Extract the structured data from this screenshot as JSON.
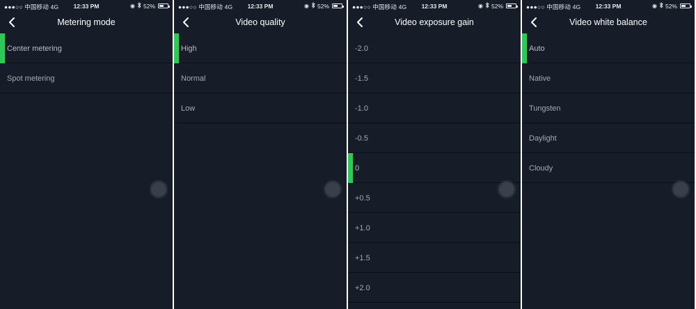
{
  "status_bar": {
    "carrier": "●●●○○ 中国移动  4G",
    "time": "12:33 PM",
    "battery": "52%",
    "battery_level": 0.52
  },
  "screens": [
    {
      "title": "Metering mode",
      "selected_index": 0,
      "items": [
        "Center metering",
        "Spot metering"
      ]
    },
    {
      "title": "Video quality",
      "selected_index": 0,
      "items": [
        "High",
        "Normal",
        "Low"
      ]
    },
    {
      "title": "Video exposure gain",
      "selected_index": 4,
      "items": [
        "-2.0",
        "-1.5",
        "-1.0",
        "-0.5",
        "0",
        "+0.5",
        "+1.0",
        "+1.5",
        "+2.0"
      ]
    },
    {
      "title": "Video white balance",
      "selected_index": 0,
      "items": [
        "Auto",
        "Native",
        "Tungsten",
        "Daylight",
        "Cloudy"
      ]
    }
  ],
  "colors": {
    "background": "#161d28",
    "accent": "#2ec85a"
  },
  "icons": {
    "back": "chevron-left-icon",
    "assistive_touch": "assistive-touch-icon",
    "bluetooth": "bluetooth-icon",
    "rotation_lock": "rotation-lock-icon",
    "battery": "battery-icon"
  }
}
